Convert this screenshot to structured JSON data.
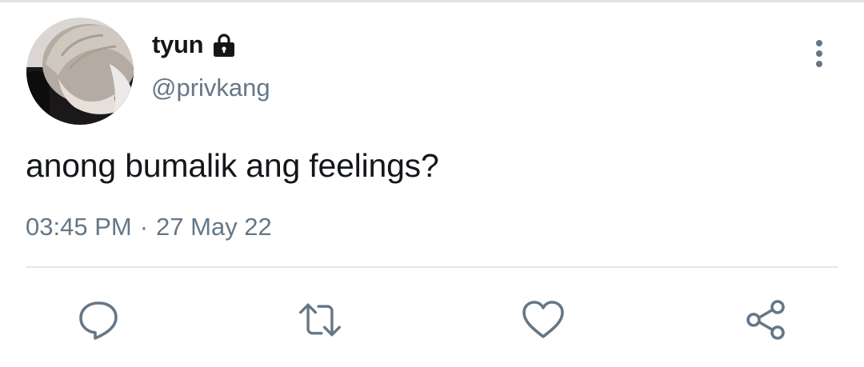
{
  "tweet": {
    "display_name": "tyun",
    "handle": "@privkang",
    "text": "anong bumalik ang feelings?",
    "time": "03:45 PM",
    "separator": "·",
    "date": "27 May 22",
    "protected_icon": "lock-icon",
    "avatar_icon": "avatar-photo"
  },
  "actions": [
    {
      "name": "reply",
      "icon": "reply-icon"
    },
    {
      "name": "retweet",
      "icon": "retweet-icon"
    },
    {
      "name": "like",
      "icon": "heart-icon"
    },
    {
      "name": "share",
      "icon": "share-icon"
    }
  ],
  "menu_icon": "more-vertical-icon",
  "colors": {
    "primary_text": "#14171a",
    "secondary_text": "#657786",
    "icon": "#657786",
    "divider": "#e1e8ed"
  }
}
